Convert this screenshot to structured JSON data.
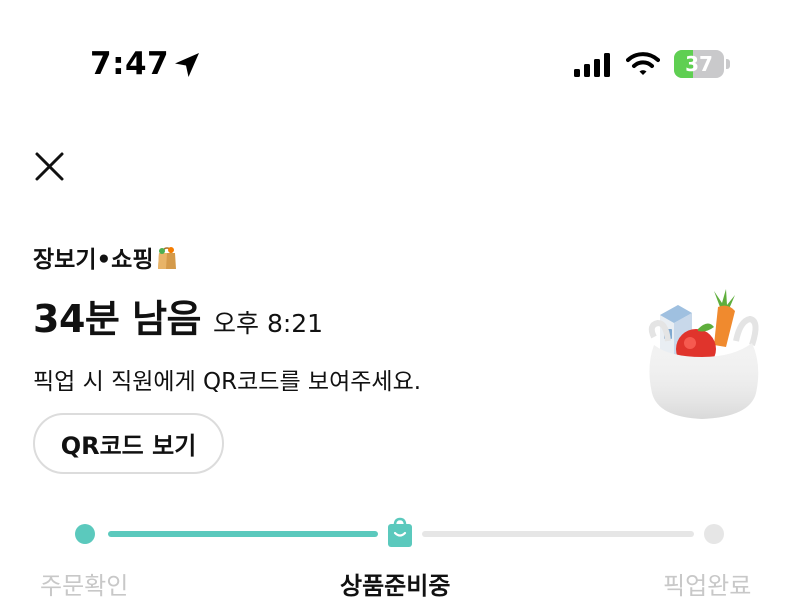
{
  "status_bar": {
    "time": "7:47",
    "battery_level": "37",
    "battery_fraction": 0.37,
    "battery_color": "#5fcf52"
  },
  "header": {
    "close_icon": "close-icon",
    "category": "장보기•쇼핑",
    "category_emoji": "paper-bag-emoji",
    "remaining_time": "34분 남음",
    "eta": "오후 8:21",
    "instruction": "픽업 시 직원에게 QR코드를 보여주세요.",
    "qr_button_label": "QR코드 보기"
  },
  "illustration": "grocery-bag-illustration",
  "progress": {
    "accent_color": "#5bc9bd",
    "inactive_color": "#e6e6e6",
    "steps": [
      {
        "label": "주문확인",
        "state": "done"
      },
      {
        "label": "상품준비중",
        "state": "current"
      },
      {
        "label": "픽업완료",
        "state": "pending"
      }
    ]
  }
}
